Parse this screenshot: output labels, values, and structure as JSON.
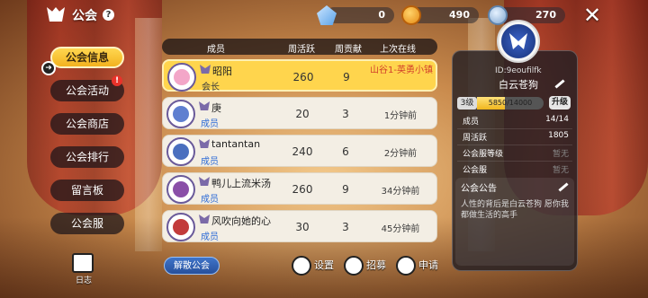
{
  "header": {
    "title": "公会",
    "help": "?",
    "currencies": [
      {
        "name": "gem",
        "icon": "gem-icon",
        "value": "0"
      },
      {
        "name": "coin",
        "icon": "coin-icon",
        "value": "490"
      },
      {
        "name": "token",
        "icon": "guild-token-icon",
        "value": "270"
      }
    ],
    "close": "✕"
  },
  "sidebar": {
    "items": [
      {
        "label": "公会信息",
        "active": true
      },
      {
        "label": "公会活动",
        "badge": "!"
      },
      {
        "label": "公会商店"
      },
      {
        "label": "公会排行"
      },
      {
        "label": "留言板"
      },
      {
        "label": "公会服"
      }
    ],
    "journal_label": "日志"
  },
  "table": {
    "headers": [
      "成员",
      "周活跃",
      "周贡献",
      "上次在线"
    ],
    "rows": [
      {
        "name": "昭阳",
        "role": "会长",
        "weekly_active": "260",
        "weekly_contrib": "9",
        "last_online": "山谷1-英勇小镇",
        "self": true
      },
      {
        "name": "庚",
        "role": "成员",
        "weekly_active": "20",
        "weekly_contrib": "3",
        "last_online": "1分钟前"
      },
      {
        "name": "tantantan",
        "role": "成员",
        "weekly_active": "240",
        "weekly_contrib": "6",
        "last_online": "2分钟前"
      },
      {
        "name": "鸭儿上流米汤",
        "role": "成员",
        "weekly_active": "260",
        "weekly_contrib": "9",
        "last_online": "34分钟前"
      },
      {
        "name": "风吹向她的心",
        "role": "成员",
        "weekly_active": "30",
        "weekly_contrib": "3",
        "last_online": "45分钟前"
      }
    ]
  },
  "footer": {
    "disband": "解散公会",
    "settings": "设置",
    "recruit": "招募",
    "apply": "申请"
  },
  "guild": {
    "id": "ID:9eoufilfk",
    "name": "白云苍狗",
    "level": "3级",
    "exp": "5850/14000",
    "exp_fraction": 0.418,
    "upgrade": "升级",
    "stats": [
      {
        "label": "成员",
        "value": "14/14",
        "dim": false
      },
      {
        "label": "周活跃",
        "value": "1805",
        "dim": false
      },
      {
        "label": "公会服等级",
        "value": "暂无",
        "dim": true
      },
      {
        "label": "公会服",
        "value": "暂无",
        "dim": true
      }
    ],
    "notice_title": "公会公告",
    "notice": "人性的背后是白云苍狗 愿你我都做生活的高手"
  },
  "colors": {
    "accent_yellow": "#ffd54d",
    "member_blue": "#2d6bd6",
    "online_red": "#d2402b",
    "panel_dark": "#231e23"
  }
}
